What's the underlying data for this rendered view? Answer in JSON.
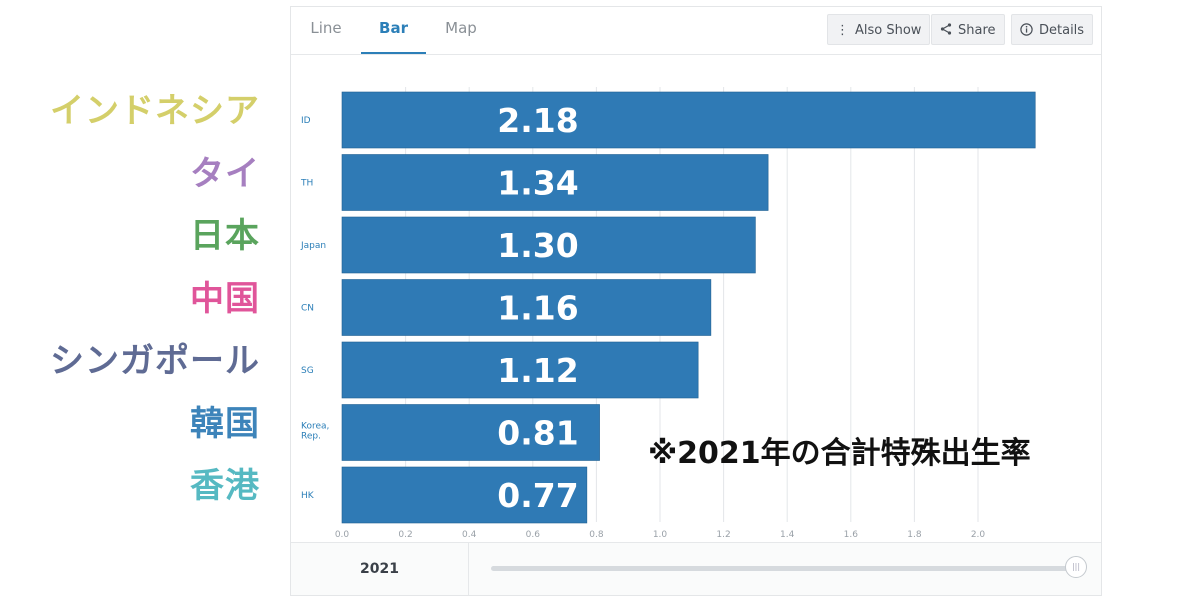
{
  "tabs": {
    "line": "Line",
    "bar": "Bar",
    "map": "Map"
  },
  "toolbar": {
    "also_show": "Also Show",
    "share": "Share",
    "details": "Details"
  },
  "footer": {
    "year": "2021",
    "slider_position": 1.0
  },
  "colors": {
    "bar": "#2f7ab5",
    "accent": "#2c7fb8"
  },
  "overlay_labels": [
    {
      "text": "インドネシア",
      "color": "#d4cf6a"
    },
    {
      "text": "タイ",
      "color": "#a67fc0"
    },
    {
      "text": "日本",
      "color": "#5aa45d"
    },
    {
      "text": "中国",
      "color": "#e0559a"
    },
    {
      "text": "シンガポール",
      "color": "#5f6b94"
    },
    {
      "text": "韓国",
      "color": "#3d84ba"
    },
    {
      "text": "香港",
      "color": "#56b9c2"
    }
  ],
  "note": "※2021年の合計特殊出生率",
  "chart_data": {
    "type": "bar",
    "orientation": "horizontal",
    "categories": [
      "ID",
      "TH",
      "Japan",
      "CN",
      "SG",
      "Korea, Rep.",
      "HK"
    ],
    "values": [
      2.18,
      1.34,
      1.3,
      1.16,
      1.12,
      0.81,
      0.77
    ],
    "value_labels": [
      "2.18",
      "1.34",
      "1.30",
      "1.16",
      "1.12",
      "0.81",
      "0.77"
    ],
    "xticks": [
      "0.0",
      "0.2",
      "0.4",
      "0.6",
      "0.8",
      "1.0",
      "1.2",
      "1.4",
      "1.6",
      "1.8",
      "2.0"
    ],
    "xlim": [
      0,
      2.2
    ],
    "grid": true,
    "title": "",
    "xlabel": "",
    "ylabel": ""
  }
}
